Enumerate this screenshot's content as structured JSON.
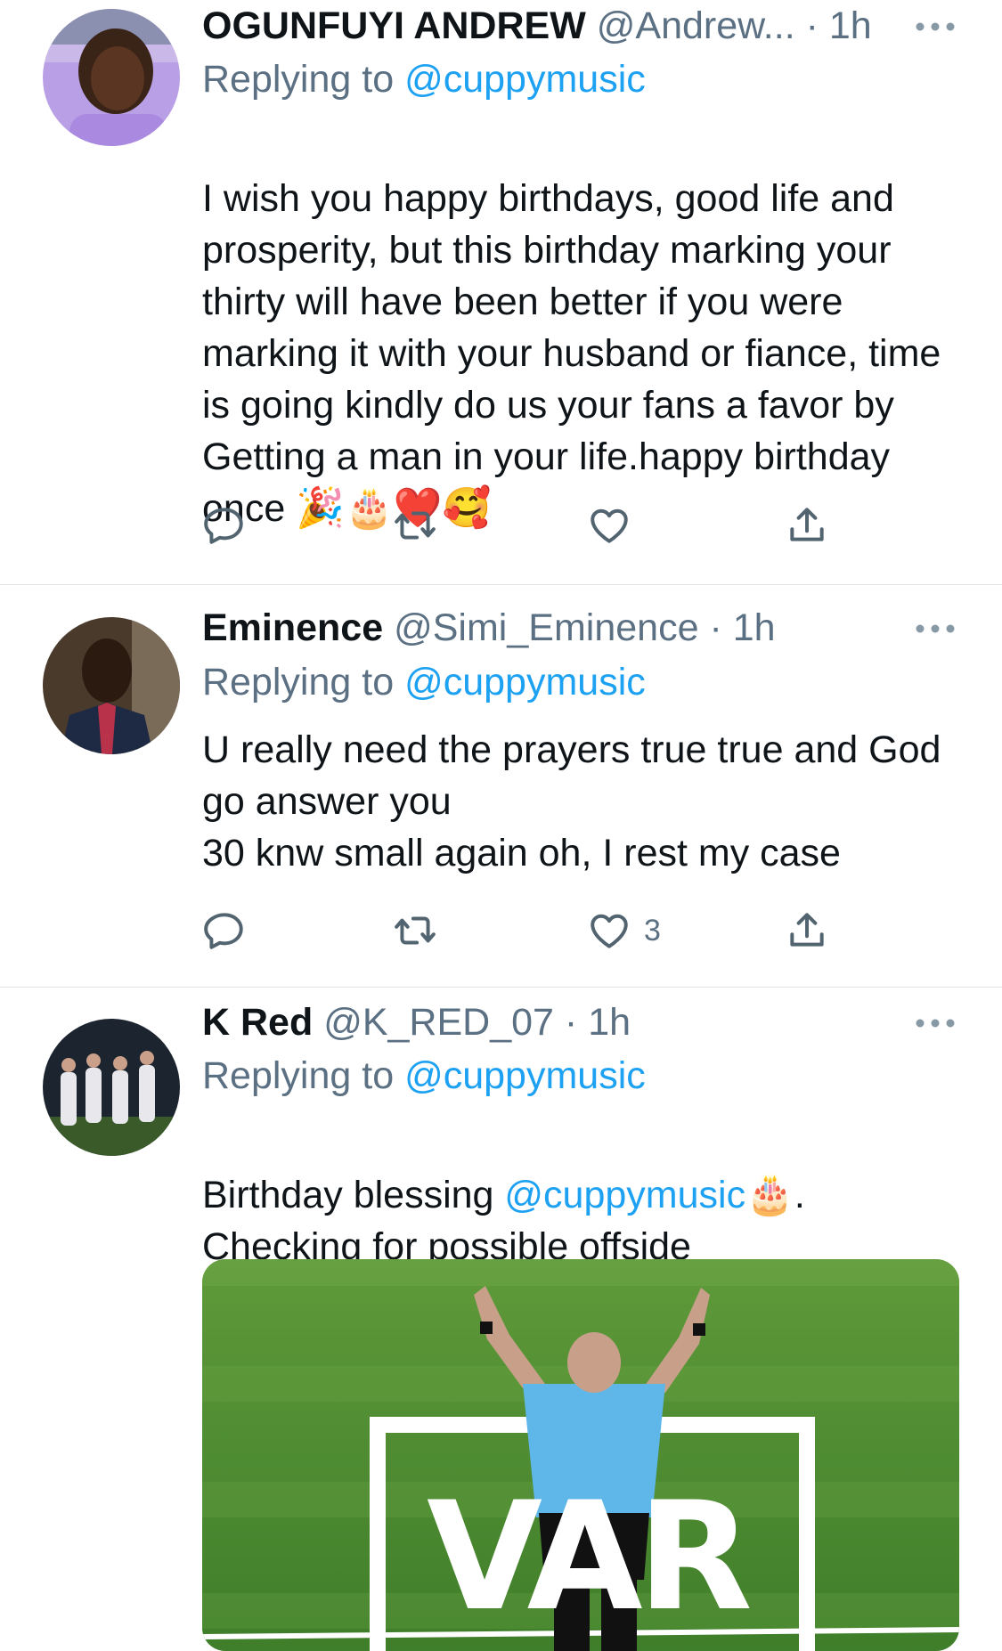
{
  "tweets": [
    {
      "name": "OGUNFUYI ANDREW",
      "handle": "@Andrew...",
      "dot": "·",
      "time": "1h",
      "replying_prefix": "Replying to ",
      "replying_to": "@cuppymusic",
      "text": "I wish you happy birthdays, good life and prosperity, but this birthday marking your thirty will have been better if you were marking it with your husband or fiance, time is going kindly do us your fans a favor by Getting a man in your life.happy birthday once ",
      "emojis": "🎉🎂❤️🥰",
      "like_count": ""
    },
    {
      "name": "Eminence",
      "handle": "@Simi_Eminence",
      "dot": "·",
      "time": "1h",
      "replying_prefix": "Replying to ",
      "replying_to": "@cuppymusic",
      "text": "U really need the prayers true true and God go answer you\n30 knw small again oh, I rest my case",
      "like_count": "3"
    },
    {
      "name": "K Red",
      "handle": "@K_RED_07",
      "dot": "·",
      "time": "1h",
      "replying_prefix": "Replying to ",
      "replying_to": "@cuppymusic",
      "text_before": "Birthday blessing ",
      "text_mention": "@cuppymusic",
      "text_emoji": "🎂",
      "text_after": ".\nChecking for possible offside",
      "media_label": "VAR"
    }
  ],
  "icons": [
    "reply-icon",
    "retweet-icon",
    "like-icon",
    "share-icon",
    "more-icon"
  ],
  "colors": {
    "link": "#1da1f2",
    "secondary": "#5b7083",
    "text": "#0f1419",
    "divider": "#dfe3e6"
  }
}
